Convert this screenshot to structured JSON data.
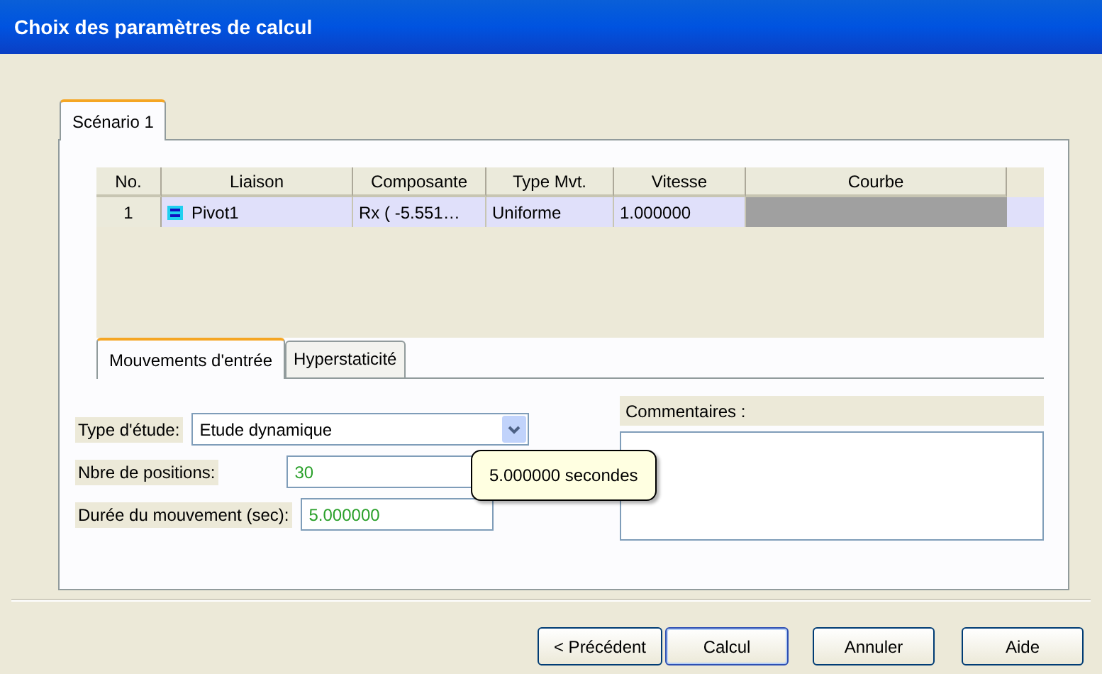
{
  "window": {
    "title": "Choix des paramètres de calcul"
  },
  "scenario_tabs": [
    {
      "label": "Scénario 1",
      "selected": true
    }
  ],
  "table": {
    "columns": [
      "No.",
      "Liaison",
      "Composante",
      "Type Mvt.",
      "Vitesse",
      "Courbe"
    ],
    "rows": [
      {
        "cells": [
          "1",
          "Pivot1",
          "Rx ( -5.551…",
          "Uniforme",
          "1.000000",
          ""
        ],
        "selected": true
      }
    ]
  },
  "inner_tabs": [
    {
      "label": "Mouvements d'entrée",
      "selected": true
    },
    {
      "label": "Hyperstaticité",
      "selected": false
    }
  ],
  "form": {
    "study_type": {
      "label": "Type d'étude:",
      "value": "Etude dynamique"
    },
    "positions": {
      "label": "Nbre de positions:",
      "value": "30"
    },
    "duration": {
      "label": "Durée du mouvement (sec):",
      "value": "5.000000"
    },
    "comments": {
      "label": "Commentaires :"
    }
  },
  "tooltip": "5.000000 secondes",
  "buttons": [
    {
      "label": "< Précédent",
      "default": false
    },
    {
      "label": "Calcul",
      "default": true
    },
    {
      "label": "Annuler",
      "default": false
    },
    {
      "label": "Aide",
      "default": false
    }
  ]
}
